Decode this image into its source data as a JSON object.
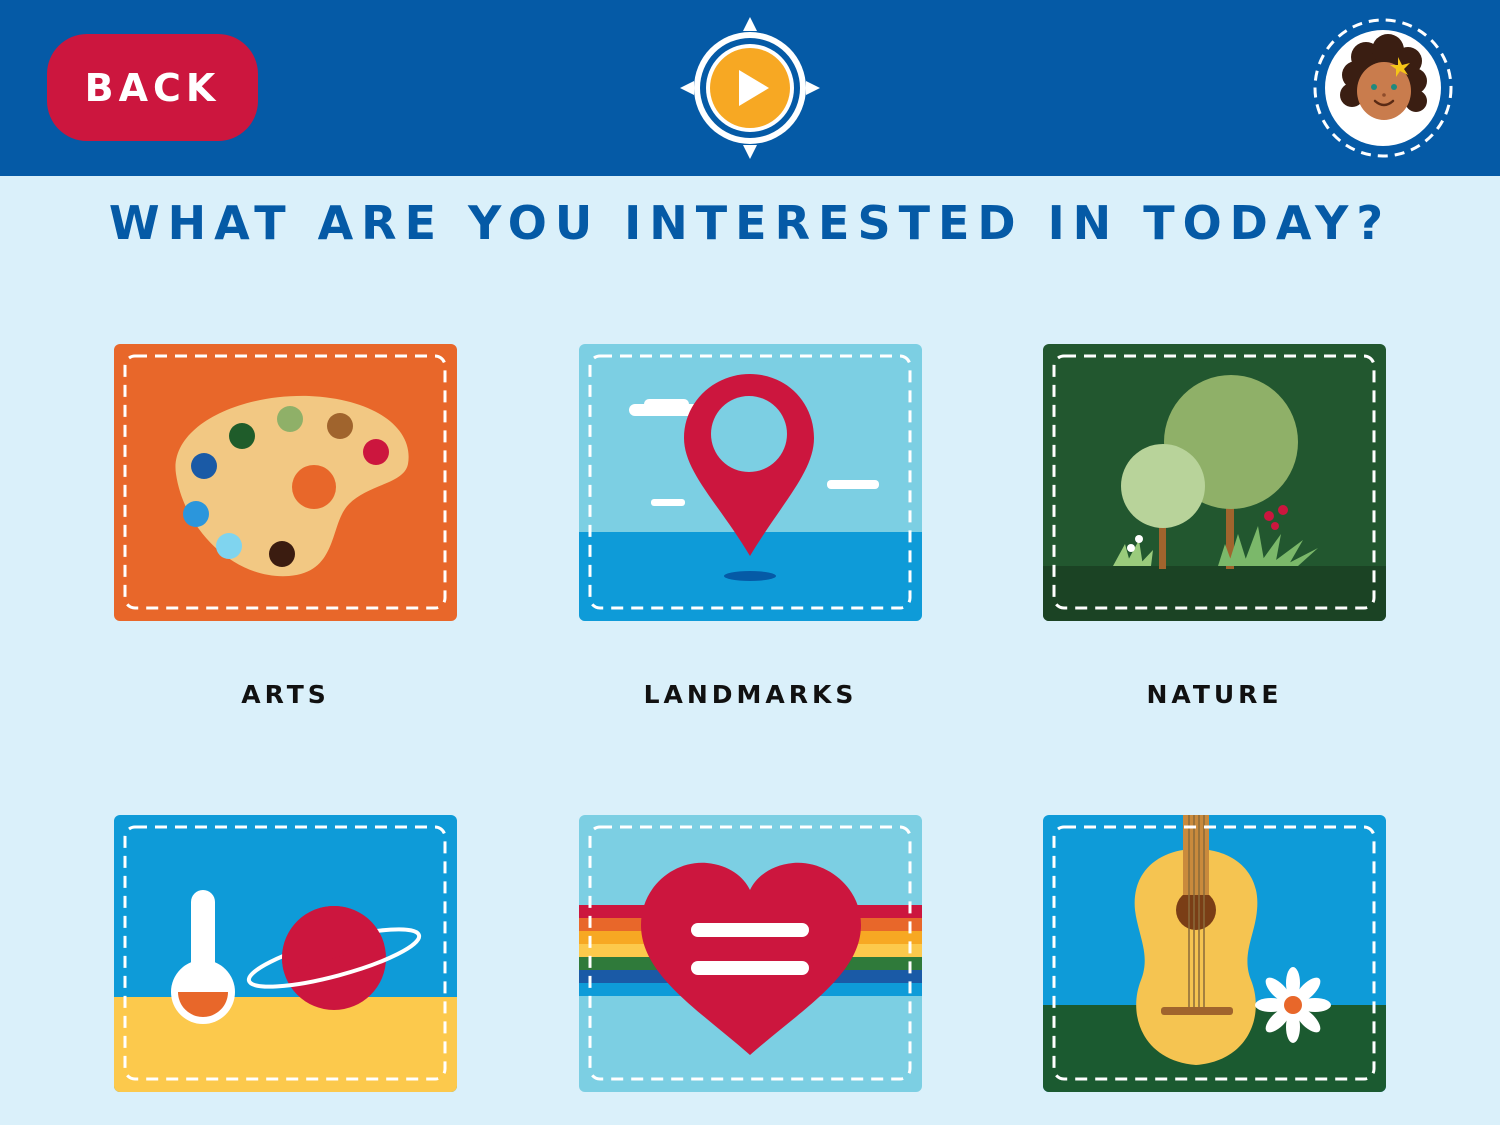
{
  "header": {
    "back_label": "BACK",
    "play_icon": "play-icon",
    "avatar_icon": "girl-avatar-icon"
  },
  "heading": "WHAT ARE YOU INTERESTED IN TODAY?",
  "categories": [
    {
      "label": "ARTS",
      "icon": "paint-palette-icon"
    },
    {
      "label": "LANDMARKS",
      "icon": "map-pin-icon"
    },
    {
      "label": "NATURE",
      "icon": "trees-icon"
    },
    {
      "label": "",
      "icon": "flask-planet-icon"
    },
    {
      "label": "",
      "icon": "rainbow-heart-icon"
    },
    {
      "label": "",
      "icon": "guitar-flower-icon"
    }
  ],
  "colors": {
    "header_bg": "#055aa6",
    "page_bg": "#daf0fa",
    "back_button": "#cc163e",
    "play_button": "#f7a823",
    "arts_tile": "#e8672a",
    "landmarks_tile": "#7ccfe3",
    "nature_tile": "#22572f"
  }
}
